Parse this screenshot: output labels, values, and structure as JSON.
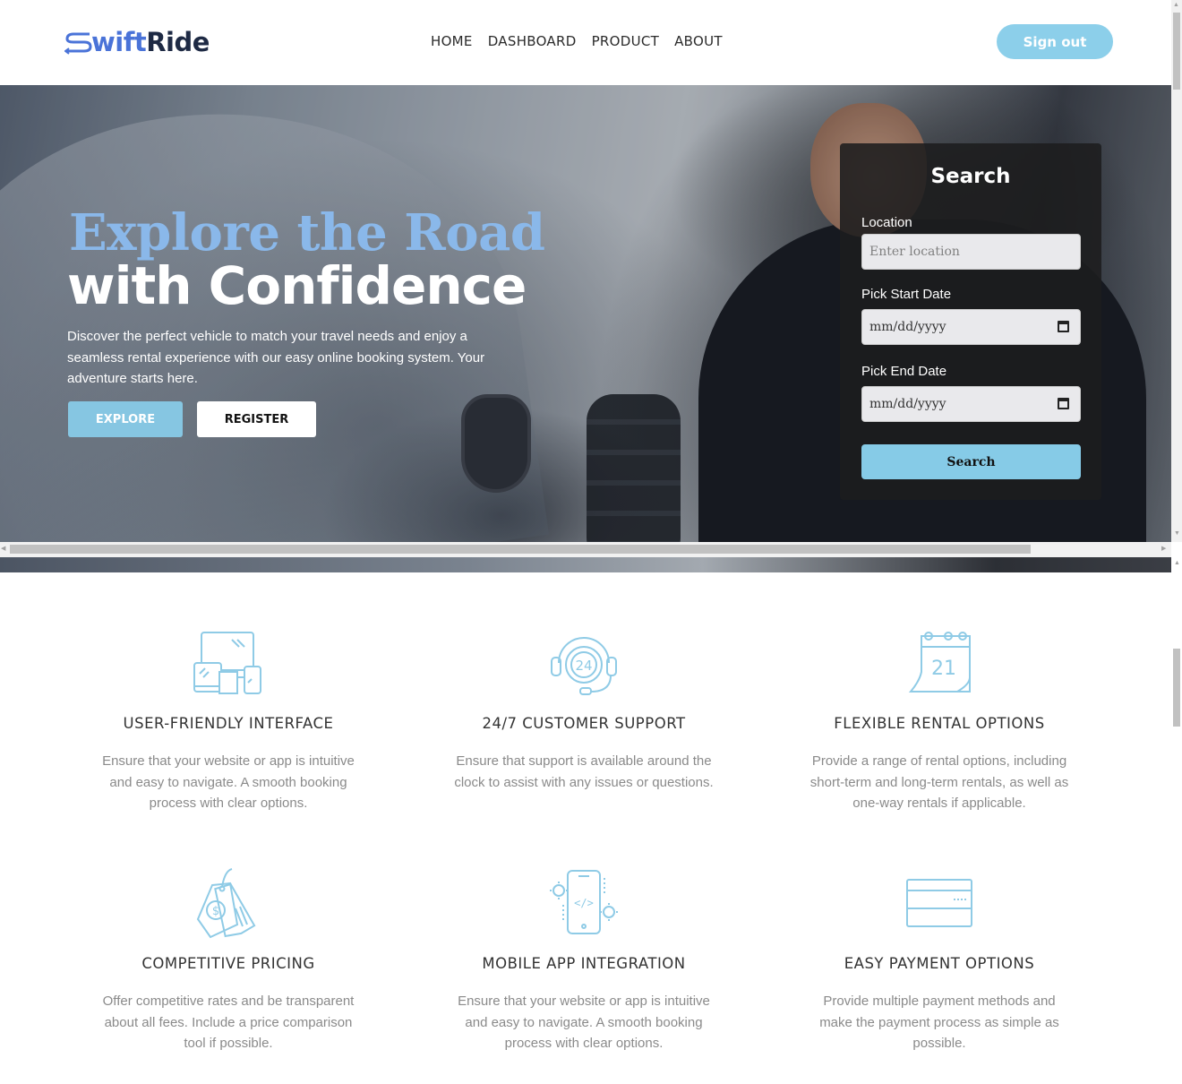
{
  "brand": {
    "logo_text_prefix": "S",
    "logo_text_mid": "wift",
    "logo_text_suffix": "Ride"
  },
  "nav": {
    "items": [
      "HOME",
      "DASHBOARD",
      "PRODUCT",
      "ABOUT"
    ],
    "signout_label": "Sign out"
  },
  "hero": {
    "title_line1": "Explore the Road",
    "title_line2": "with Confidence",
    "description": "Discover the perfect vehicle to match your travel needs and enjoy a seamless rental experience with our easy online booking system. Your adventure starts here.",
    "explore_label": "EXPLORE",
    "register_label": "REGISTER"
  },
  "search": {
    "title": "Search",
    "location_label": "Location",
    "location_placeholder": "Enter location",
    "start_label": "Pick Start Date",
    "start_value": "mm/dd/yyyy",
    "end_label": "Pick End Date",
    "end_value": "mm/dd/yyyy",
    "button_label": "Search"
  },
  "features": [
    {
      "icon": "devices-icon",
      "title": "USER-FRIENDLY INTERFACE",
      "description": "Ensure that your website or app is intuitive and easy to navigate. A smooth booking process with clear options."
    },
    {
      "icon": "headset-24-icon",
      "title": "24/7 CUSTOMER SUPPORT",
      "description": "Ensure that support is available around the clock to assist with any issues or questions."
    },
    {
      "icon": "calendar-21-icon",
      "title": "FLEXIBLE RENTAL OPTIONS",
      "description": "Provide a range of rental options, including short-term and long-term rentals, as well as one-way rentals if applicable."
    },
    {
      "icon": "price-tag-icon",
      "title": "COMPETITIVE PRICING",
      "description": "Offer competitive rates and be transparent about all fees. Include a price comparison tool if possible."
    },
    {
      "icon": "mobile-code-icon",
      "title": "MOBILE APP INTEGRATION",
      "description": "Ensure that your website or app is intuitive and easy to navigate. A smooth booking process with clear options."
    },
    {
      "icon": "credit-card-icon",
      "title": "EASY PAYMENT OPTIONS",
      "description": "Provide multiple payment methods and make the payment process as simple as possible."
    }
  ],
  "colors": {
    "accent": "#86c6e2",
    "icon_stroke": "#8fcbe6",
    "title_blue": "#8ab8ea",
    "logo_blue": "#4a73d8",
    "logo_dark": "#1e2a44"
  }
}
